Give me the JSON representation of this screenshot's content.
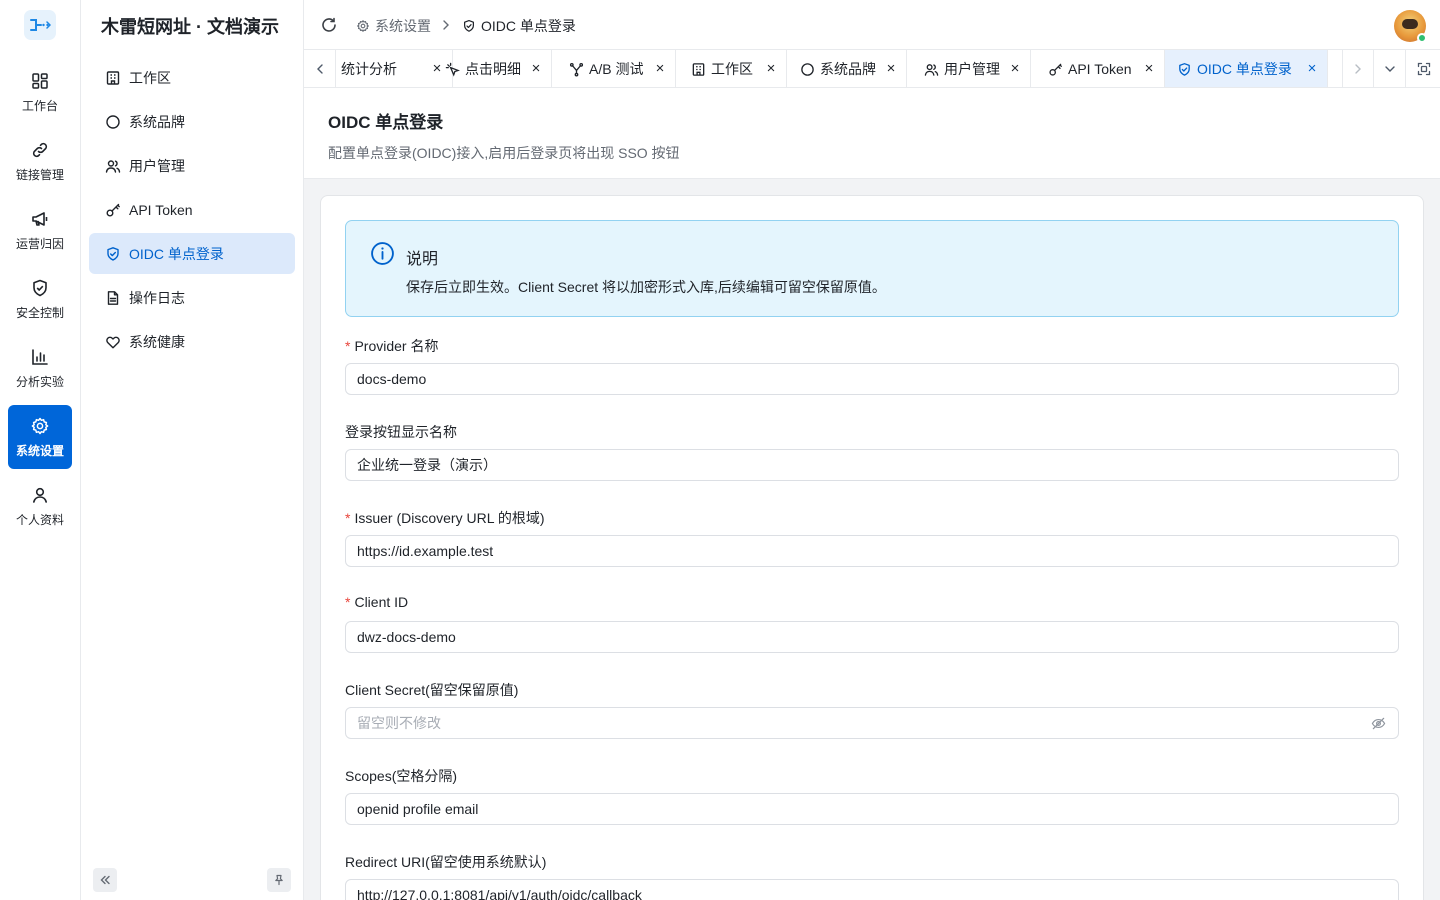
{
  "rail": {
    "items": [
      {
        "label": "工作台",
        "icon": "dashboard-icon"
      },
      {
        "label": "链接管理",
        "icon": "link-icon"
      },
      {
        "label": "运营归因",
        "icon": "megaphone-icon"
      },
      {
        "label": "安全控制",
        "icon": "shield-icon"
      },
      {
        "label": "分析实验",
        "icon": "bar-chart-icon"
      },
      {
        "label": "系统设置",
        "icon": "gear-icon",
        "active": true
      },
      {
        "label": "个人资料",
        "icon": "user-icon"
      }
    ]
  },
  "sidebar": {
    "title": "木雷短网址 · 文档演示",
    "items": [
      {
        "label": "工作区",
        "icon": "building-icon"
      },
      {
        "label": "系统品牌",
        "icon": "circle-icon"
      },
      {
        "label": "用户管理",
        "icon": "users-icon"
      },
      {
        "label": "API Token",
        "icon": "key-icon"
      },
      {
        "label": "OIDC 单点登录",
        "icon": "shield-check-icon",
        "active": true
      },
      {
        "label": "操作日志",
        "icon": "document-icon"
      },
      {
        "label": "系统健康",
        "icon": "heart-icon"
      }
    ]
  },
  "header": {
    "breadcrumb": [
      {
        "label": "系统设置",
        "icon": "gear-icon"
      },
      {
        "label": "OIDC 单点登录",
        "icon": "shield-check-icon"
      }
    ]
  },
  "tabs": [
    {
      "label": "统计分析",
      "icon": ""
    },
    {
      "label": "点击明细",
      "icon": "sparkle-icon"
    },
    {
      "label": "A/B 测试",
      "icon": "split-icon"
    },
    {
      "label": "工作区",
      "icon": "building-icon"
    },
    {
      "label": "系统品牌",
      "icon": "circle-icon"
    },
    {
      "label": "用户管理",
      "icon": "users-icon"
    },
    {
      "label": "API Token",
      "icon": "key-icon"
    },
    {
      "label": "OIDC 单点登录",
      "icon": "shield-check-icon",
      "active": true
    }
  ],
  "page": {
    "title": "OIDC 单点登录",
    "description": "配置单点登录(OIDC)接入,启用后登录页将出现 SSO 按钮"
  },
  "notice": {
    "title": "说明",
    "text": "保存后立即生效。Client Secret 将以加密形式入库,后续编辑可留空保留原值。"
  },
  "form": {
    "provider": {
      "label": "Provider 名称",
      "required": "*",
      "value": "docs-demo"
    },
    "button_name": {
      "label": "登录按钮显示名称",
      "value": "企业统一登录（演示）"
    },
    "issuer": {
      "label": "Issuer (Discovery URL 的根域)",
      "required": "*",
      "value": "https://id.example.test"
    },
    "client_id": {
      "label": "Client ID",
      "required": "*",
      "value": "dwz-docs-demo"
    },
    "client_secret": {
      "label": "Client Secret(留空保留原值)",
      "value": "",
      "placeholder": "留空则不修改"
    },
    "scopes": {
      "label": "Scopes(空格分隔)",
      "value": "openid profile email"
    },
    "redirect_uri": {
      "label": "Redirect URI(留空使用系统默认)",
      "value": "http://127.0.0.1:8081/api/v1/auth/oidc/callback"
    }
  },
  "colors": {
    "accent": "#0066d9",
    "active_bg": "#dce9fb",
    "notice_bg": "#e4f5fd",
    "required": "#e8453c"
  }
}
